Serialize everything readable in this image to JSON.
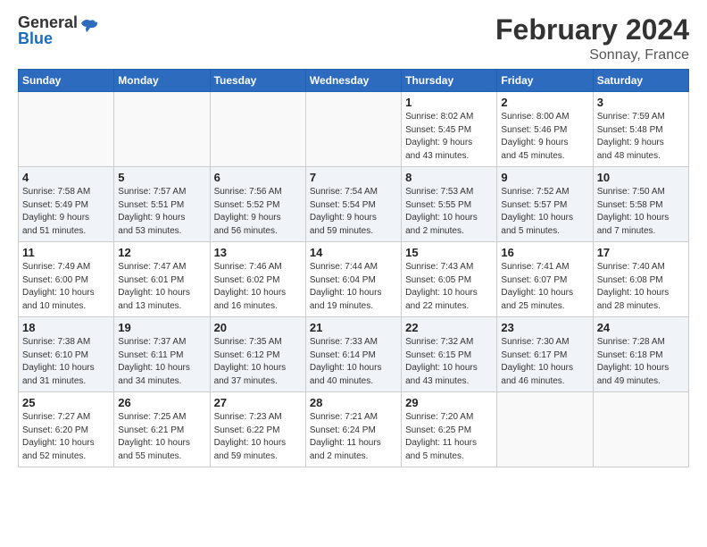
{
  "header": {
    "logo_general": "General",
    "logo_blue": "Blue",
    "title": "February 2024",
    "subtitle": "Sonnay, France"
  },
  "calendar": {
    "days_of_week": [
      "Sunday",
      "Monday",
      "Tuesday",
      "Wednesday",
      "Thursday",
      "Friday",
      "Saturday"
    ],
    "weeks": [
      [
        {
          "day": "",
          "info": ""
        },
        {
          "day": "",
          "info": ""
        },
        {
          "day": "",
          "info": ""
        },
        {
          "day": "",
          "info": ""
        },
        {
          "day": "1",
          "info": "Sunrise: 8:02 AM\nSunset: 5:45 PM\nDaylight: 9 hours\nand 43 minutes."
        },
        {
          "day": "2",
          "info": "Sunrise: 8:00 AM\nSunset: 5:46 PM\nDaylight: 9 hours\nand 45 minutes."
        },
        {
          "day": "3",
          "info": "Sunrise: 7:59 AM\nSunset: 5:48 PM\nDaylight: 9 hours\nand 48 minutes."
        }
      ],
      [
        {
          "day": "4",
          "info": "Sunrise: 7:58 AM\nSunset: 5:49 PM\nDaylight: 9 hours\nand 51 minutes."
        },
        {
          "day": "5",
          "info": "Sunrise: 7:57 AM\nSunset: 5:51 PM\nDaylight: 9 hours\nand 53 minutes."
        },
        {
          "day": "6",
          "info": "Sunrise: 7:56 AM\nSunset: 5:52 PM\nDaylight: 9 hours\nand 56 minutes."
        },
        {
          "day": "7",
          "info": "Sunrise: 7:54 AM\nSunset: 5:54 PM\nDaylight: 9 hours\nand 59 minutes."
        },
        {
          "day": "8",
          "info": "Sunrise: 7:53 AM\nSunset: 5:55 PM\nDaylight: 10 hours\nand 2 minutes."
        },
        {
          "day": "9",
          "info": "Sunrise: 7:52 AM\nSunset: 5:57 PM\nDaylight: 10 hours\nand 5 minutes."
        },
        {
          "day": "10",
          "info": "Sunrise: 7:50 AM\nSunset: 5:58 PM\nDaylight: 10 hours\nand 7 minutes."
        }
      ],
      [
        {
          "day": "11",
          "info": "Sunrise: 7:49 AM\nSunset: 6:00 PM\nDaylight: 10 hours\nand 10 minutes."
        },
        {
          "day": "12",
          "info": "Sunrise: 7:47 AM\nSunset: 6:01 PM\nDaylight: 10 hours\nand 13 minutes."
        },
        {
          "day": "13",
          "info": "Sunrise: 7:46 AM\nSunset: 6:02 PM\nDaylight: 10 hours\nand 16 minutes."
        },
        {
          "day": "14",
          "info": "Sunrise: 7:44 AM\nSunset: 6:04 PM\nDaylight: 10 hours\nand 19 minutes."
        },
        {
          "day": "15",
          "info": "Sunrise: 7:43 AM\nSunset: 6:05 PM\nDaylight: 10 hours\nand 22 minutes."
        },
        {
          "day": "16",
          "info": "Sunrise: 7:41 AM\nSunset: 6:07 PM\nDaylight: 10 hours\nand 25 minutes."
        },
        {
          "day": "17",
          "info": "Sunrise: 7:40 AM\nSunset: 6:08 PM\nDaylight: 10 hours\nand 28 minutes."
        }
      ],
      [
        {
          "day": "18",
          "info": "Sunrise: 7:38 AM\nSunset: 6:10 PM\nDaylight: 10 hours\nand 31 minutes."
        },
        {
          "day": "19",
          "info": "Sunrise: 7:37 AM\nSunset: 6:11 PM\nDaylight: 10 hours\nand 34 minutes."
        },
        {
          "day": "20",
          "info": "Sunrise: 7:35 AM\nSunset: 6:12 PM\nDaylight: 10 hours\nand 37 minutes."
        },
        {
          "day": "21",
          "info": "Sunrise: 7:33 AM\nSunset: 6:14 PM\nDaylight: 10 hours\nand 40 minutes."
        },
        {
          "day": "22",
          "info": "Sunrise: 7:32 AM\nSunset: 6:15 PM\nDaylight: 10 hours\nand 43 minutes."
        },
        {
          "day": "23",
          "info": "Sunrise: 7:30 AM\nSunset: 6:17 PM\nDaylight: 10 hours\nand 46 minutes."
        },
        {
          "day": "24",
          "info": "Sunrise: 7:28 AM\nSunset: 6:18 PM\nDaylight: 10 hours\nand 49 minutes."
        }
      ],
      [
        {
          "day": "25",
          "info": "Sunrise: 7:27 AM\nSunset: 6:20 PM\nDaylight: 10 hours\nand 52 minutes."
        },
        {
          "day": "26",
          "info": "Sunrise: 7:25 AM\nSunset: 6:21 PM\nDaylight: 10 hours\nand 55 minutes."
        },
        {
          "day": "27",
          "info": "Sunrise: 7:23 AM\nSunset: 6:22 PM\nDaylight: 10 hours\nand 59 minutes."
        },
        {
          "day": "28",
          "info": "Sunrise: 7:21 AM\nSunset: 6:24 PM\nDaylight: 11 hours\nand 2 minutes."
        },
        {
          "day": "29",
          "info": "Sunrise: 7:20 AM\nSunset: 6:25 PM\nDaylight: 11 hours\nand 5 minutes."
        },
        {
          "day": "",
          "info": ""
        },
        {
          "day": "",
          "info": ""
        }
      ]
    ]
  }
}
